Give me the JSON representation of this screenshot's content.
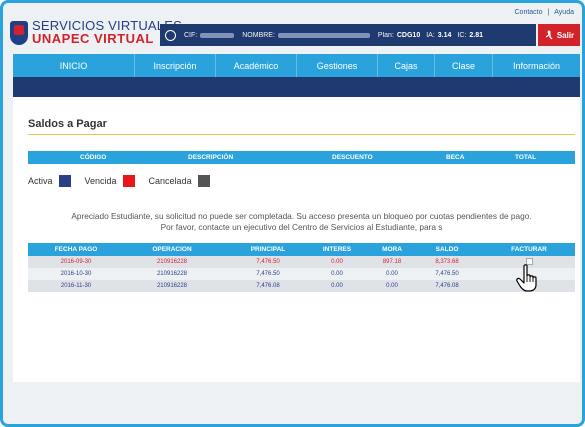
{
  "toplinks": {
    "contacto": "Contacto",
    "sep": "|",
    "ayuda": "Ayuda"
  },
  "logo": {
    "line1": "SERVICIOS VIRTUALES",
    "line2": "UNAPEC VIRTUAL"
  },
  "infobar": {
    "cif_label": "CIF:",
    "nombre_label": "NOMBRE:",
    "plan_label": "Plan:",
    "plan_value": "CDG10",
    "ia_label": "IA:",
    "ia_value": "3.14",
    "ic_label": "IC:",
    "ic_value": "2.81",
    "salir_label": "Salir"
  },
  "nav": [
    {
      "label": "INICIO"
    },
    {
      "label": "Inscripción"
    },
    {
      "label": "Académico"
    },
    {
      "label": "Gestiones"
    },
    {
      "label": "Cajas"
    },
    {
      "label": "Clase"
    },
    {
      "label": "Información"
    }
  ],
  "page": {
    "title": "Saldos a Pagar"
  },
  "summary_headers": [
    "CÓDIGO",
    "DESCRIPCIÓN",
    "DESCUENTO",
    "BECA",
    "TOTAL"
  ],
  "legend": {
    "activa": "Activa",
    "activa_color": "#2a3f86",
    "vencida": "Vencida",
    "vencida_color": "#e8151b",
    "cancelada": "Cancelada",
    "cancelada_color": "#555555"
  },
  "message": {
    "line1": "Apreciado Estudiante, su solicitud no puede ser completada. Su acceso presenta un bloqueo por cuotas pendientes de pago.",
    "line2": "Por favor, contacte un ejecutivo del Centro de Servicios al Estudiante, para s"
  },
  "payments": {
    "headers": [
      "FECHA PAGO",
      "OPERACION",
      "PRINCIPAL",
      "INTERES",
      "MORA",
      "SALDO",
      "FACTURAR"
    ],
    "rows": [
      {
        "fecha": "2016-09-30",
        "operacion": "210916228",
        "principal": "7,476.50",
        "interes": "0.00",
        "mora": "897.18",
        "saldo": "8,373.68",
        "status": "vencida"
      },
      {
        "fecha": "2016-10-30",
        "operacion": "210916228",
        "principal": "7,476.50",
        "interes": "0.00",
        "mora": "0.00",
        "saldo": "7,476.50",
        "status": "activa"
      },
      {
        "fecha": "2016-11-30",
        "operacion": "210916228",
        "principal": "7,476.08",
        "interes": "0.00",
        "mora": "0.00",
        "saldo": "7,476.08",
        "status": "activa"
      }
    ]
  }
}
